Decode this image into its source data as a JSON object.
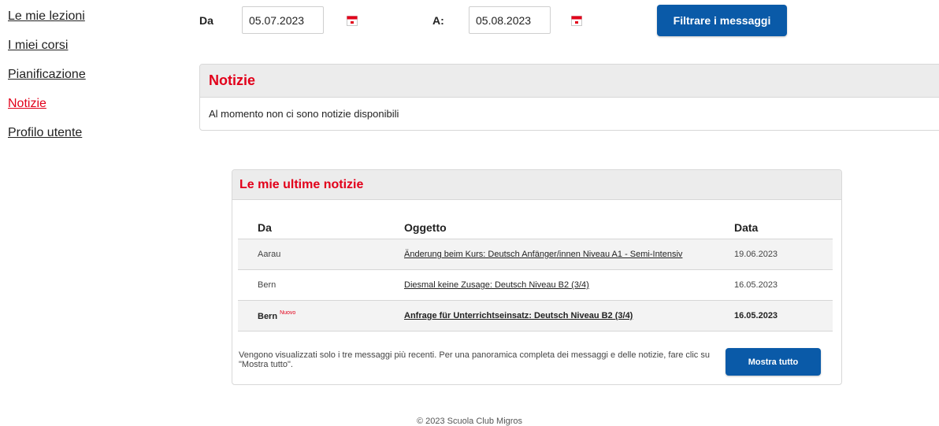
{
  "sidebar": {
    "items": [
      {
        "label": "Le mie lezioni"
      },
      {
        "label": "I miei corsi"
      },
      {
        "label": "Pianificazione"
      },
      {
        "label": "Notizie"
      },
      {
        "label": "Profilo utente"
      }
    ],
    "active_item": "Notizie"
  },
  "filter": {
    "from_label": "Da",
    "from_value": "05.07.2023",
    "to_label": "A:",
    "to_value": "05.08.2023",
    "calendar_icon": "calendar-icon",
    "button_label": "Filtrare i messaggi"
  },
  "news_panel": {
    "title": "Notizie",
    "empty_message": "Al momento non ci sono notizie disponibili"
  },
  "latest": {
    "title": "Le mie ultime notizie",
    "columns": [
      "Da",
      "Oggetto",
      "Data"
    ],
    "rows": [
      {
        "from": "Aarau",
        "subject": "Änderung beim Kurs: Deutsch Anfänger/innen Niveau A1 - Semi-Intensiv",
        "date": "19.06.2023",
        "new": ""
      },
      {
        "from": "Bern",
        "subject": "Diesmal keine Zusage: Deutsch Niveau B2 (3/4)",
        "date": "16.05.2023",
        "new": ""
      },
      {
        "from": "Bern",
        "subject": "Anfrage für Unterrichtseinsatz: Deutsch Niveau B2 (3/4)",
        "date": "16.05.2023",
        "new": "Nuovo"
      }
    ],
    "footnote": "Vengono visualizzati solo i tre messaggi più recenti. Per una panoramica completa dei messaggi e delle notizie, fare clic su \"Mostra tutto\".",
    "show_all_label": "Mostra tutto"
  },
  "footer": {
    "text": "© 2023 Scuola Club Migros"
  },
  "colors": {
    "accent_red": "#e2001a",
    "button_blue": "#0a5aa8",
    "header_grey": "#ececec"
  }
}
